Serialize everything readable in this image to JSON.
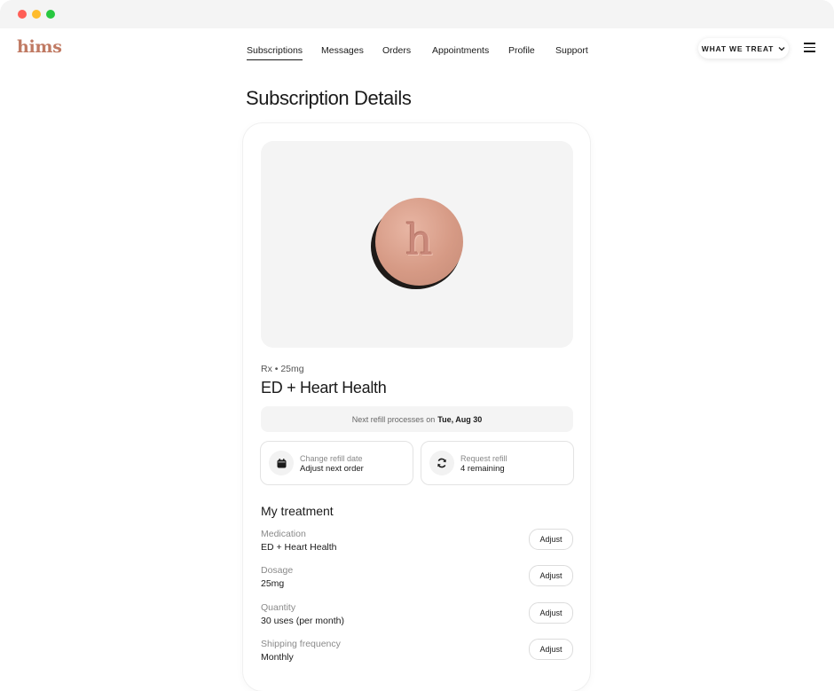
{
  "brand": {
    "logo_text": "hims",
    "color": "#c07a63"
  },
  "nav": {
    "items": [
      {
        "label": "Subscriptions",
        "active": true
      },
      {
        "label": "Messages"
      },
      {
        "label": "Orders"
      },
      {
        "label": "Appointments"
      },
      {
        "label": "Profile"
      },
      {
        "label": "Support"
      }
    ],
    "what_we_treat": "WHAT WE TREAT",
    "menu_icon": "hamburger-menu-icon"
  },
  "page": {
    "title": "Subscription Details"
  },
  "product": {
    "pill_letter": "h",
    "rx_line": "Rx • 25mg",
    "name": "ED + Heart Health"
  },
  "refill": {
    "prefix": "Next refill processes on",
    "date": "Tue, Aug 30"
  },
  "actions": [
    {
      "title": "Change refill date",
      "subtitle": "Adjust next order",
      "icon": "calendar-icon"
    },
    {
      "title": "Request refill",
      "subtitle": "4 remaining",
      "icon": "refresh-icon"
    }
  ],
  "treatment": {
    "title": "My treatment",
    "adjust_label": "Adjust",
    "rows": [
      {
        "label": "Medication",
        "value": "ED + Heart Health"
      },
      {
        "label": "Dosage",
        "value": "25mg"
      },
      {
        "label": "Quantity",
        "value": "30 uses (per month)"
      },
      {
        "label": "Shipping frequency",
        "value": "Monthly"
      }
    ]
  }
}
